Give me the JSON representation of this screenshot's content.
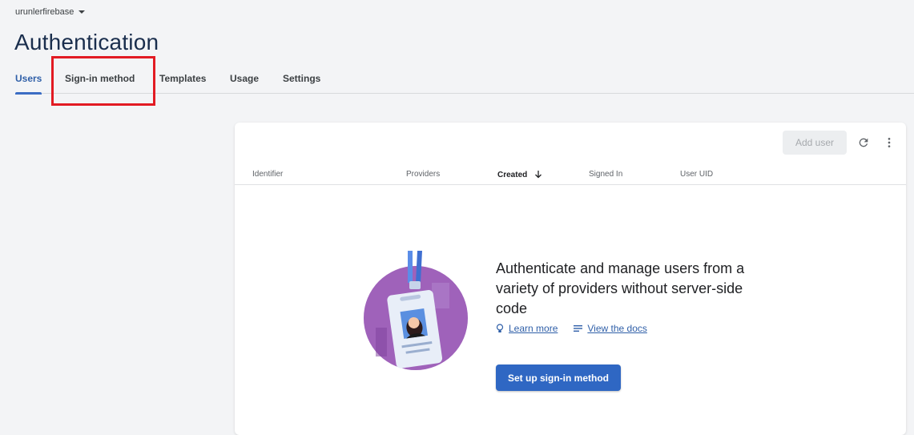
{
  "project": {
    "name": "urunlerfirebase"
  },
  "page": {
    "title": "Authentication"
  },
  "tabs": [
    {
      "label": "Users",
      "active": true
    },
    {
      "label": "Sign-in method",
      "active": false
    },
    {
      "label": "Templates",
      "active": false
    },
    {
      "label": "Usage",
      "active": false
    },
    {
      "label": "Settings",
      "active": false
    }
  ],
  "toolbar": {
    "add_user_label": "Add user",
    "refresh_icon": "refresh-icon",
    "more_icon": "more-vert-icon"
  },
  "table": {
    "columns": [
      {
        "label": "Identifier"
      },
      {
        "label": "Providers"
      },
      {
        "label": "Created",
        "sorted": "desc"
      },
      {
        "label": "Signed In"
      },
      {
        "label": "User UID"
      }
    ]
  },
  "empty_state": {
    "message": "Authenticate and manage users from a variety of providers without server-side code",
    "learn_more": "Learn more",
    "view_docs": "View the docs",
    "cta": "Set up sign-in method"
  },
  "colors": {
    "accent": "#2f67c3",
    "annotation": "#e21b23",
    "illustration": "#9b59b6"
  }
}
